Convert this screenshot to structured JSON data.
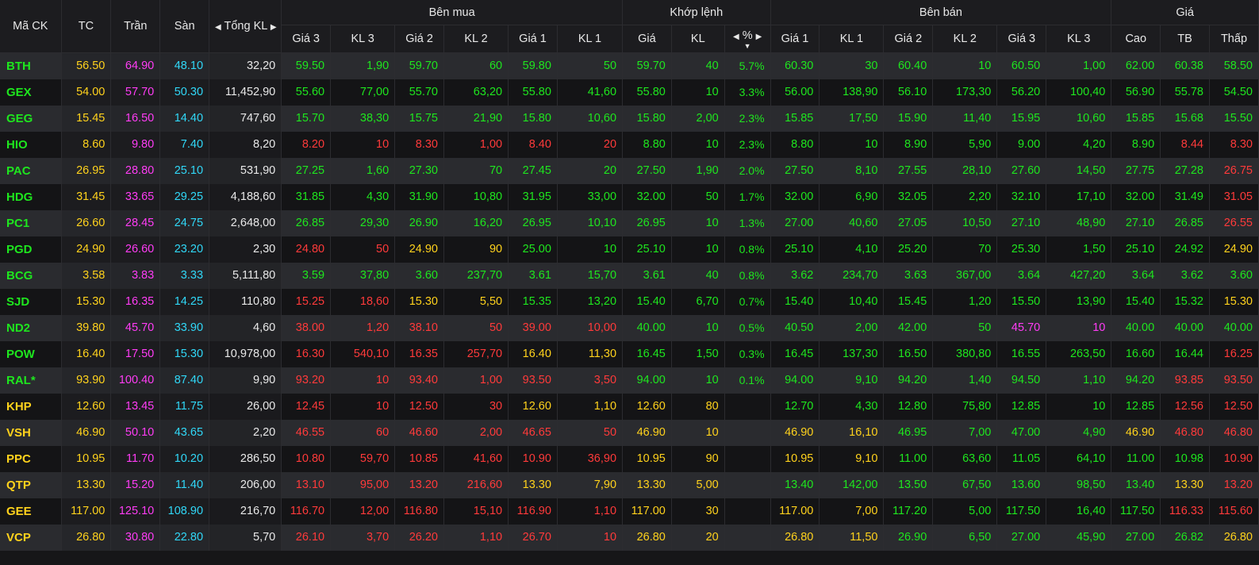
{
  "headers": {
    "symbol": "Mã CK",
    "ref": "TC",
    "ceiling": "Trần",
    "floor": "Sàn",
    "total_vol": "Tổng KL",
    "buy_group": "Bên mua",
    "match_group": "Khớp lệnh",
    "sell_group": "Bên bán",
    "price_group": "Giá",
    "buy": [
      "Giá 3",
      "KL 3",
      "Giá 2",
      "KL 2",
      "Giá 1",
      "KL 1"
    ],
    "match_price": "Giá",
    "match_vol": "KL",
    "match_pct": "%",
    "sell": [
      "Giá 1",
      "KL 1",
      "Giá 2",
      "KL 2",
      "Giá 3",
      "KL 3"
    ],
    "high": "Cao",
    "avg": "TB",
    "low": "Thấp"
  },
  "colors": {
    "up": "#1ee61e",
    "down": "#ff3a3a",
    "ref": "#ffd21c",
    "floor": "#30d8f8",
    "ceiling": "#ff3cf5",
    "neutral": "#e8e8e8"
  },
  "rows": [
    {
      "sym": "BTH",
      "tc": "56.50",
      "tran": "64.90",
      "san": "48.10",
      "tkl": "32,20",
      "b3p": "59.50",
      "b3v": "1,90",
      "b2p": "59.70",
      "b2v": "60",
      "b1p": "59.80",
      "b1v": "50",
      "mp": "59.70",
      "mv": "40",
      "pct": "5.7%",
      "s1p": "60.30",
      "s1v": "30",
      "s2p": "60.40",
      "s2v": "10",
      "s3p": "60.50",
      "s3v": "1,00",
      "hi": "62.00",
      "avg": "60.38",
      "lo": "58.50"
    },
    {
      "sym": "GEX",
      "tc": "54.00",
      "tran": "57.70",
      "san": "50.30",
      "tkl": "11,452,90",
      "b3p": "55.60",
      "b3v": "77,00",
      "b2p": "55.70",
      "b2v": "63,20",
      "b1p": "55.80",
      "b1v": "41,60",
      "mp": "55.80",
      "mv": "10",
      "pct": "3.3%",
      "s1p": "56.00",
      "s1v": "138,90",
      "s2p": "56.10",
      "s2v": "173,30",
      "s3p": "56.20",
      "s3v": "100,40",
      "hi": "56.90",
      "avg": "55.78",
      "lo": "54.50"
    },
    {
      "sym": "GEG",
      "tc": "15.45",
      "tran": "16.50",
      "san": "14.40",
      "tkl": "747,60",
      "b3p": "15.70",
      "b3v": "38,30",
      "b2p": "15.75",
      "b2v": "21,90",
      "b1p": "15.80",
      "b1v": "10,60",
      "mp": "15.80",
      "mv": "2,00",
      "pct": "2.3%",
      "s1p": "15.85",
      "s1v": "17,50",
      "s2p": "15.90",
      "s2v": "11,40",
      "s3p": "15.95",
      "s3v": "10,60",
      "hi": "15.85",
      "avg": "15.68",
      "lo": "15.50"
    },
    {
      "sym": "HIO",
      "tc": "8.60",
      "tran": "9.80",
      "san": "7.40",
      "tkl": "8,20",
      "b3p": "8.20",
      "b3v": "10",
      "b2p": "8.30",
      "b2v": "1,00",
      "b1p": "8.40",
      "b1v": "20",
      "mp": "8.80",
      "mv": "10",
      "pct": "2.3%",
      "s1p": "8.80",
      "s1v": "10",
      "s2p": "8.90",
      "s2v": "5,90",
      "s3p": "9.00",
      "s3v": "4,20",
      "hi": "8.90",
      "avg": "8.44",
      "lo": "8.30"
    },
    {
      "sym": "PAC",
      "tc": "26.95",
      "tran": "28.80",
      "san": "25.10",
      "tkl": "531,90",
      "b3p": "27.25",
      "b3v": "1,60",
      "b2p": "27.30",
      "b2v": "70",
      "b1p": "27.45",
      "b1v": "20",
      "mp": "27.50",
      "mv": "1,90",
      "pct": "2.0%",
      "s1p": "27.50",
      "s1v": "8,10",
      "s2p": "27.55",
      "s2v": "28,10",
      "s3p": "27.60",
      "s3v": "14,50",
      "hi": "27.75",
      "avg": "27.28",
      "lo": "26.75"
    },
    {
      "sym": "HDG",
      "tc": "31.45",
      "tran": "33.65",
      "san": "29.25",
      "tkl": "4,188,60",
      "b3p": "31.85",
      "b3v": "4,30",
      "b2p": "31.90",
      "b2v": "10,80",
      "b1p": "31.95",
      "b1v": "33,00",
      "mp": "32.00",
      "mv": "50",
      "pct": "1.7%",
      "s1p": "32.00",
      "s1v": "6,90",
      "s2p": "32.05",
      "s2v": "2,20",
      "s3p": "32.10",
      "s3v": "17,10",
      "hi": "32.00",
      "avg": "31.49",
      "lo": "31.05"
    },
    {
      "sym": "PC1",
      "tc": "26.60",
      "tran": "28.45",
      "san": "24.75",
      "tkl": "2,648,00",
      "b3p": "26.85",
      "b3v": "29,30",
      "b2p": "26.90",
      "b2v": "16,20",
      "b1p": "26.95",
      "b1v": "10,10",
      "mp": "26.95",
      "mv": "10",
      "pct": "1.3%",
      "s1p": "27.00",
      "s1v": "40,60",
      "s2p": "27.05",
      "s2v": "10,50",
      "s3p": "27.10",
      "s3v": "48,90",
      "hi": "27.10",
      "avg": "26.85",
      "lo": "26.55"
    },
    {
      "sym": "PGD",
      "tc": "24.90",
      "tran": "26.60",
      "san": "23.20",
      "tkl": "2,30",
      "b3p": "24.80",
      "b3v": "50",
      "b2p": "24.90",
      "b2v": "90",
      "b1p": "25.00",
      "b1v": "10",
      "mp": "25.10",
      "mv": "10",
      "pct": "0.8%",
      "s1p": "25.10",
      "s1v": "4,10",
      "s2p": "25.20",
      "s2v": "70",
      "s3p": "25.30",
      "s3v": "1,50",
      "hi": "25.10",
      "avg": "24.92",
      "lo": "24.90"
    },
    {
      "sym": "BCG",
      "tc": "3.58",
      "tran": "3.83",
      "san": "3.33",
      "tkl": "5,111,80",
      "b3p": "3.59",
      "b3v": "37,80",
      "b2p": "3.60",
      "b2v": "237,70",
      "b1p": "3.61",
      "b1v": "15,70",
      "mp": "3.61",
      "mv": "40",
      "pct": "0.8%",
      "s1p": "3.62",
      "s1v": "234,70",
      "s2p": "3.63",
      "s2v": "367,00",
      "s3p": "3.64",
      "s3v": "427,20",
      "hi": "3.64",
      "avg": "3.62",
      "lo": "3.60"
    },
    {
      "sym": "SJD",
      "tc": "15.30",
      "tran": "16.35",
      "san": "14.25",
      "tkl": "110,80",
      "b3p": "15.25",
      "b3v": "18,60",
      "b2p": "15.30",
      "b2v": "5,50",
      "b1p": "15.35",
      "b1v": "13,20",
      "mp": "15.40",
      "mv": "6,70",
      "pct": "0.7%",
      "s1p": "15.40",
      "s1v": "10,40",
      "s2p": "15.45",
      "s2v": "1,20",
      "s3p": "15.50",
      "s3v": "13,90",
      "hi": "15.40",
      "avg": "15.32",
      "lo": "15.30"
    },
    {
      "sym": "ND2",
      "tc": "39.80",
      "tran": "45.70",
      "san": "33.90",
      "tkl": "4,60",
      "b3p": "38.00",
      "b3v": "1,20",
      "b2p": "38.10",
      "b2v": "50",
      "b1p": "39.00",
      "b1v": "10,00",
      "mp": "40.00",
      "mv": "10",
      "pct": "0.5%",
      "s1p": "40.50",
      "s1v": "2,00",
      "s2p": "42.00",
      "s2v": "50",
      "s3p": "45.70",
      "s3v": "10",
      "hi": "40.00",
      "avg": "40.00",
      "lo": "40.00"
    },
    {
      "sym": "POW",
      "tc": "16.40",
      "tran": "17.50",
      "san": "15.30",
      "tkl": "10,978,00",
      "b3p": "16.30",
      "b3v": "540,10",
      "b2p": "16.35",
      "b2v": "257,70",
      "b1p": "16.40",
      "b1v": "11,30",
      "mp": "16.45",
      "mv": "1,50",
      "pct": "0.3%",
      "s1p": "16.45",
      "s1v": "137,30",
      "s2p": "16.50",
      "s2v": "380,80",
      "s3p": "16.55",
      "s3v": "263,50",
      "hi": "16.60",
      "avg": "16.44",
      "lo": "16.25"
    },
    {
      "sym": "RAL*",
      "tc": "93.90",
      "tran": "100.40",
      "san": "87.40",
      "tkl": "9,90",
      "b3p": "93.20",
      "b3v": "10",
      "b2p": "93.40",
      "b2v": "1,00",
      "b1p": "93.50",
      "b1v": "3,50",
      "mp": "94.00",
      "mv": "10",
      "pct": "0.1%",
      "s1p": "94.00",
      "s1v": "9,10",
      "s2p": "94.20",
      "s2v": "1,40",
      "s3p": "94.50",
      "s3v": "1,10",
      "hi": "94.20",
      "avg": "93.85",
      "lo": "93.50"
    },
    {
      "sym": "KHP",
      "tc": "12.60",
      "tran": "13.45",
      "san": "11.75",
      "tkl": "26,00",
      "b3p": "12.45",
      "b3v": "10",
      "b2p": "12.50",
      "b2v": "30",
      "b1p": "12.60",
      "b1v": "1,10",
      "mp": "12.60",
      "mv": "80",
      "pct": "",
      "s1p": "12.70",
      "s1v": "4,30",
      "s2p": "12.80",
      "s2v": "75,80",
      "s3p": "12.85",
      "s3v": "10",
      "hi": "12.85",
      "avg": "12.56",
      "lo": "12.50"
    },
    {
      "sym": "VSH",
      "tc": "46.90",
      "tran": "50.10",
      "san": "43.65",
      "tkl": "2,20",
      "b3p": "46.55",
      "b3v": "60",
      "b2p": "46.60",
      "b2v": "2,00",
      "b1p": "46.65",
      "b1v": "50",
      "mp": "46.90",
      "mv": "10",
      "pct": "",
      "s1p": "46.90",
      "s1v": "16,10",
      "s2p": "46.95",
      "s2v": "7,00",
      "s3p": "47.00",
      "s3v": "4,90",
      "hi": "46.90",
      "avg": "46.80",
      "lo": "46.80"
    },
    {
      "sym": "PPC",
      "tc": "10.95",
      "tran": "11.70",
      "san": "10.20",
      "tkl": "286,50",
      "b3p": "10.80",
      "b3v": "59,70",
      "b2p": "10.85",
      "b2v": "41,60",
      "b1p": "10.90",
      "b1v": "36,90",
      "mp": "10.95",
      "mv": "90",
      "pct": "",
      "s1p": "10.95",
      "s1v": "9,10",
      "s2p": "11.00",
      "s2v": "63,60",
      "s3p": "11.05",
      "s3v": "64,10",
      "hi": "11.00",
      "avg": "10.98",
      "lo": "10.90"
    },
    {
      "sym": "QTP",
      "tc": "13.30",
      "tran": "15.20",
      "san": "11.40",
      "tkl": "206,00",
      "b3p": "13.10",
      "b3v": "95,00",
      "b2p": "13.20",
      "b2v": "216,60",
      "b1p": "13.30",
      "b1v": "7,90",
      "mp": "13.30",
      "mv": "5,00",
      "pct": "",
      "s1p": "13.40",
      "s1v": "142,00",
      "s2p": "13.50",
      "s2v": "67,50",
      "s3p": "13.60",
      "s3v": "98,50",
      "hi": "13.40",
      "avg": "13.30",
      "lo": "13.20"
    },
    {
      "sym": "GEE",
      "tc": "117.00",
      "tran": "125.10",
      "san": "108.90",
      "tkl": "216,70",
      "b3p": "116.70",
      "b3v": "12,00",
      "b2p": "116.80",
      "b2v": "15,10",
      "b1p": "116.90",
      "b1v": "1,10",
      "mp": "117.00",
      "mv": "30",
      "pct": "",
      "s1p": "117.00",
      "s1v": "7,00",
      "s2p": "117.20",
      "s2v": "5,00",
      "s3p": "117.50",
      "s3v": "16,40",
      "hi": "117.50",
      "avg": "116.33",
      "lo": "115.60"
    },
    {
      "sym": "VCP",
      "tc": "26.80",
      "tran": "30.80",
      "san": "22.80",
      "tkl": "5,70",
      "b3p": "26.10",
      "b3v": "3,70",
      "b2p": "26.20",
      "b2v": "1,10",
      "b1p": "26.70",
      "b1v": "10",
      "mp": "26.80",
      "mv": "20",
      "pct": "",
      "s1p": "26.80",
      "s1v": "11,50",
      "s2p": "26.90",
      "s2v": "6,50",
      "s3p": "27.00",
      "s3v": "45,90",
      "hi": "27.00",
      "avg": "26.82",
      "lo": "26.80"
    }
  ]
}
